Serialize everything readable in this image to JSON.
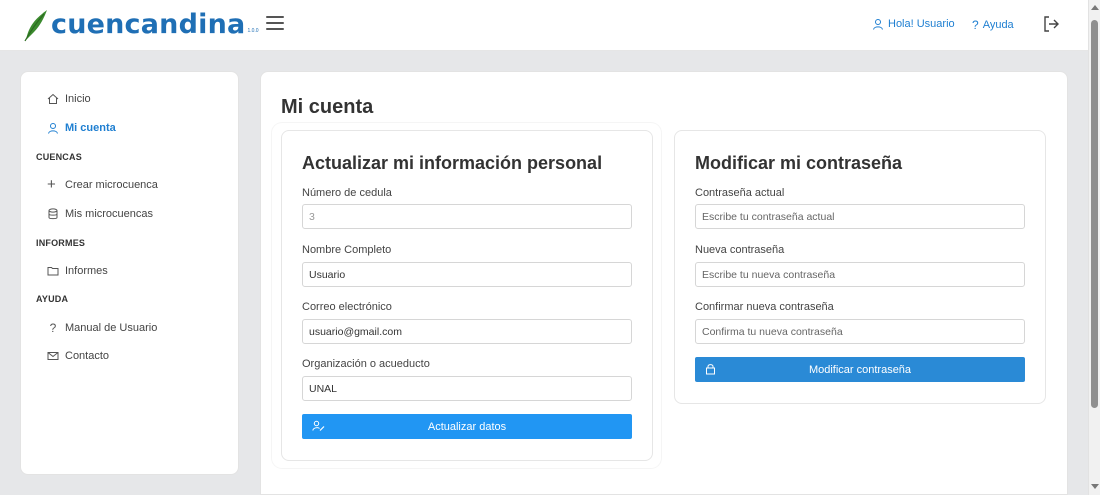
{
  "header": {
    "logo_text": "cuencandina",
    "logo_suffix": "1.0.0",
    "user_greeting": "Hola! Usuario",
    "help_label": "Ayuda"
  },
  "sidebar": {
    "items": [
      {
        "label": "Inicio",
        "icon": "home-icon"
      },
      {
        "label": "Mi cuenta",
        "icon": "user-icon",
        "active": true
      }
    ],
    "sections": [
      {
        "title": "CUENCAS",
        "items": [
          {
            "label": "Crear microcuenca",
            "icon": "plus-icon"
          },
          {
            "label": "Mis microcuencas",
            "icon": "database-icon"
          }
        ]
      },
      {
        "title": "INFORMES",
        "items": [
          {
            "label": "Informes",
            "icon": "folder-icon"
          }
        ]
      },
      {
        "title": "AYUDA",
        "items": [
          {
            "label": "Manual de Usuario",
            "icon": "question-icon"
          },
          {
            "label": "Contacto",
            "icon": "mail-icon"
          }
        ]
      }
    ]
  },
  "main": {
    "page_title": "Mi cuenta"
  },
  "personal_form": {
    "title": "Actualizar mi información personal",
    "cedula_label": "Número de cedula",
    "cedula_value": "3",
    "nombre_label": "Nombre Completo",
    "nombre_value": "Usuario",
    "correo_label": "Correo electrónico",
    "correo_value": "usuario@gmail.com",
    "org_label": "Organización o acueducto",
    "org_value": "UNAL",
    "submit_label": "Actualizar datos"
  },
  "password_form": {
    "title": "Modificar mi contraseña",
    "current_label": "Contraseña actual",
    "current_placeholder": "Escribe tu contraseña actual",
    "new_label": "Nueva contraseña",
    "new_placeholder": "Escribe tu nueva contraseña",
    "confirm_label": "Confirmar nueva contraseña",
    "confirm_placeholder": "Confirma tu nueva contraseña",
    "submit_label": "Modificar contraseña"
  },
  "colors": {
    "brand": "#1f6fb5",
    "accent": "#2196f3",
    "link": "#1f7fd1",
    "leaf": "#3b8a2e"
  }
}
